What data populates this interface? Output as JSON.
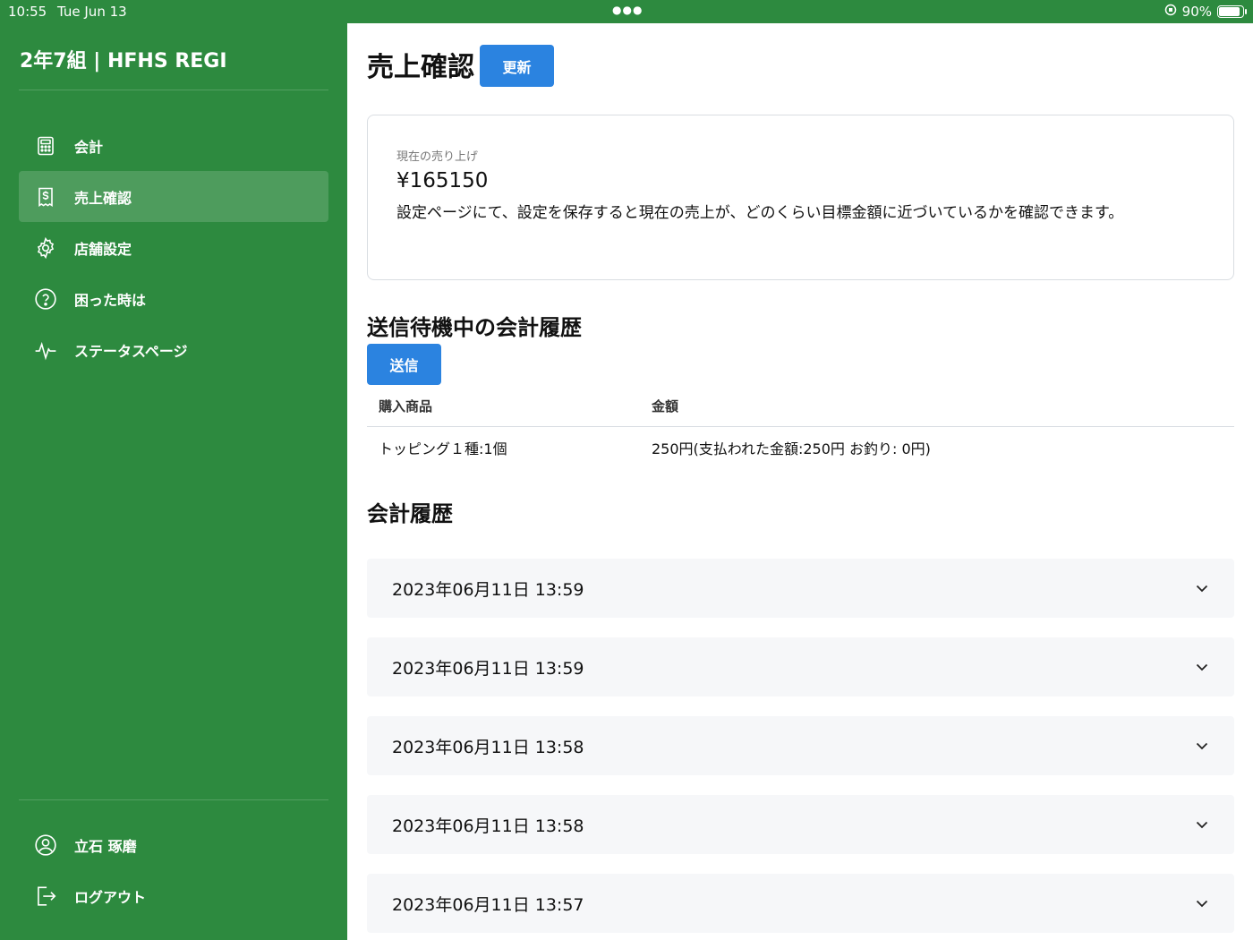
{
  "status_bar": {
    "time": "10:55",
    "date": "Tue Jun 13",
    "battery": "90%",
    "battery_level": 0.9
  },
  "sidebar": {
    "brand": "2年7組 | HFHS REGI",
    "items": [
      {
        "label": "会計",
        "icon": "calculator-icon",
        "active": false
      },
      {
        "label": "売上確認",
        "icon": "receipt-icon",
        "active": true
      },
      {
        "label": "店舗設定",
        "icon": "gear-icon",
        "active": false
      },
      {
        "label": "困った時は",
        "icon": "help-icon",
        "active": false
      },
      {
        "label": "ステータスページ",
        "icon": "activity-icon",
        "active": false
      }
    ],
    "user_name": "立石 琢磨",
    "logout_label": "ログアウト"
  },
  "main": {
    "title": "売上確認",
    "refresh_label": "更新",
    "sales_card": {
      "label": "現在の売り上げ",
      "value": "¥165150",
      "description": "設定ページにて、設定を保存すると現在の売上が、どのくらい目標金額に近づいているかを確認できます。"
    },
    "pending": {
      "title": "送信待機中の会計履歴",
      "send_label": "送信",
      "columns": [
        "購入商品",
        "金額"
      ],
      "rows": [
        {
          "item": "トッピング１種:1個",
          "amount": "250円(支払われた金額:250円 お釣り: 0円)"
        }
      ]
    },
    "history": {
      "title": "会計履歴",
      "entries": [
        "2023年06月11日 13:59",
        "2023年06月11日 13:59",
        "2023年06月11日 13:58",
        "2023年06月11日 13:58",
        "2023年06月11日 13:57"
      ]
    }
  },
  "colors": {
    "sidebar_green": "#2d8a3f",
    "button_blue": "#2b83e0"
  }
}
